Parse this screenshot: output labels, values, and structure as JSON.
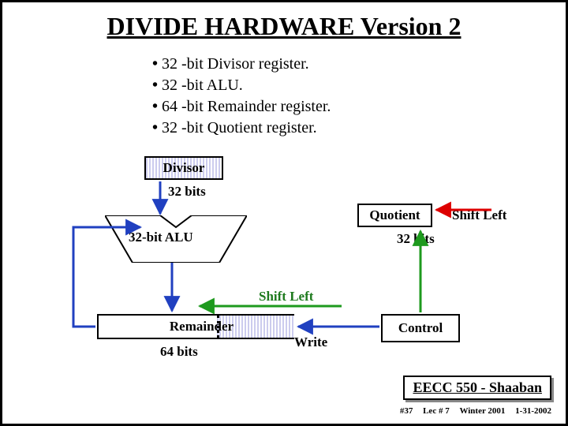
{
  "title": "DIVIDE HARDWARE Version 2",
  "bullets": {
    "b1": "32 -bit Divisor register.",
    "b2": "32 -bit ALU.",
    "b3": " 64 -bit Remainder register.",
    "b4": "32 -bit Quotient register."
  },
  "blocks": {
    "divisor": "Divisor",
    "quotient": "Quotient",
    "alu": "32-bit ALU",
    "remainder": "Remainder",
    "control": "Control"
  },
  "labels": {
    "bits32a": "32 bits",
    "bits32b": "32 bits",
    "bits64": "64 bits",
    "shiftLeft1": "Shift Left",
    "shiftLeft2": "Shift Left",
    "write": "Write"
  },
  "footer": {
    "course": "EECC 550 - Shaaban",
    "slide": "#37",
    "lec": "Lec # 7",
    "term": "Winter 2001",
    "date": "1-31-2002"
  }
}
